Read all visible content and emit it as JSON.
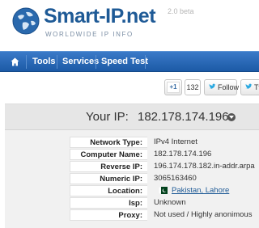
{
  "header": {
    "logo": "Smart-IP.net",
    "version": "2.0 beta",
    "tagline": "WORLDWIDE IP INFO"
  },
  "nav": {
    "items": [
      "Tools",
      "Services",
      "Speed Test"
    ]
  },
  "social": {
    "plus_one": "+1",
    "plus_count": "132",
    "follow": "Follow",
    "tweet_partial": "Tv"
  },
  "ip": {
    "label": "Your IP:",
    "value": "182.178.174.196"
  },
  "details": {
    "rows": [
      {
        "key": "Network Type:",
        "value": "IPv4 Internet"
      },
      {
        "key": "Computer Name:",
        "value": "182.178.174.196"
      },
      {
        "key": "Reverse IP:",
        "value": "196.174.178.182.in-addr.arpa"
      },
      {
        "key": "Numeric IP:",
        "value": "3065163460"
      },
      {
        "key": "Location:",
        "value": "Pakistan, Lahore"
      },
      {
        "key": "Isp:",
        "value": "Unknown"
      },
      {
        "key": "Proxy:",
        "value": "Not used / Highly anonimous"
      }
    ]
  },
  "colors": {
    "brand": "#1e5a96",
    "nav": "#1c5aa6"
  }
}
